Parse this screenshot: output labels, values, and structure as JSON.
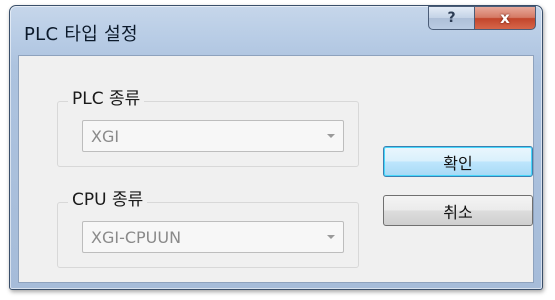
{
  "window": {
    "title": "PLC 타입 설정",
    "help_glyph": "?",
    "close_glyph": "x"
  },
  "plc_group": {
    "label": "PLC 종류",
    "selected": "XGI"
  },
  "cpu_group": {
    "label": "CPU 종류",
    "selected": "XGI-CPUUN"
  },
  "buttons": {
    "ok_label": "확인",
    "cancel_label": "취소"
  },
  "colors": {
    "title_bar": "#b9cde6",
    "close_button": "#c2452b",
    "default_button_border": "#3c7fb1"
  }
}
